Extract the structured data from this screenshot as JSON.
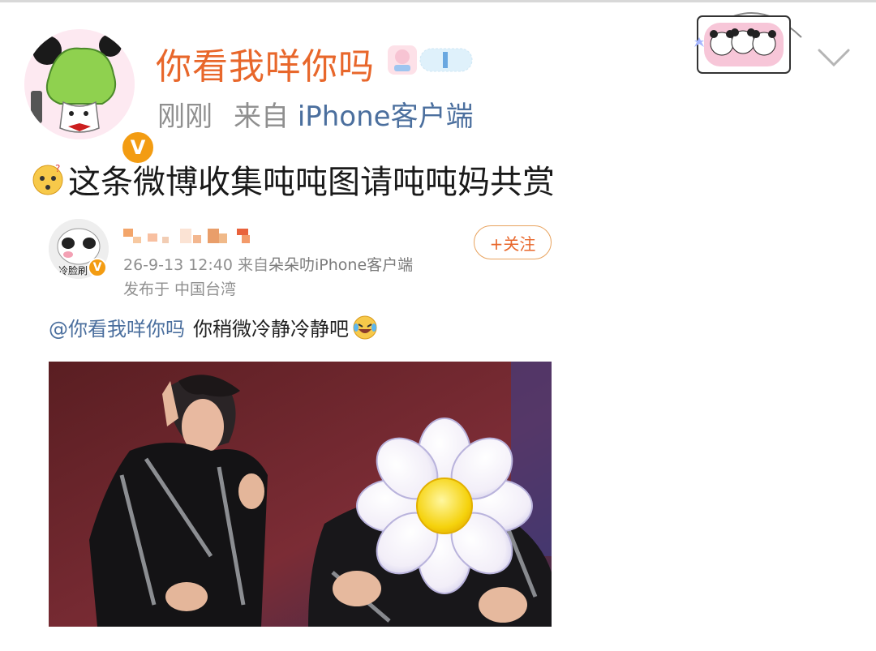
{
  "post": {
    "author": "你看我咩你吗",
    "time": "刚刚",
    "source_prefix": "来自",
    "source": "iPhone客户端",
    "verified_mark": "V",
    "text": "这条微博收集吨吨图请吨吨妈共赏"
  },
  "repost": {
    "time": "26-9-13 12:40",
    "source_prefix": "来自",
    "source": "朵朵叻iPhone客户端",
    "location": "发布于 中国台湾",
    "follow_label": "+关注",
    "mention": "@你看我咩你吗",
    "text": "你稍微冷静冷静吧",
    "avatar_text": "冷脸刷",
    "verified_mark": "V"
  },
  "icons": [
    "avatar-icon",
    "verified-icon",
    "chevron-down-icon",
    "thinking-emoji-icon",
    "laughing-emoji-icon",
    "flower-sticker-icon"
  ],
  "colors": {
    "accent": "#e8672b",
    "link": "#4b6f9e",
    "meta": "#8f8f8f",
    "badge": "#f39c12"
  }
}
